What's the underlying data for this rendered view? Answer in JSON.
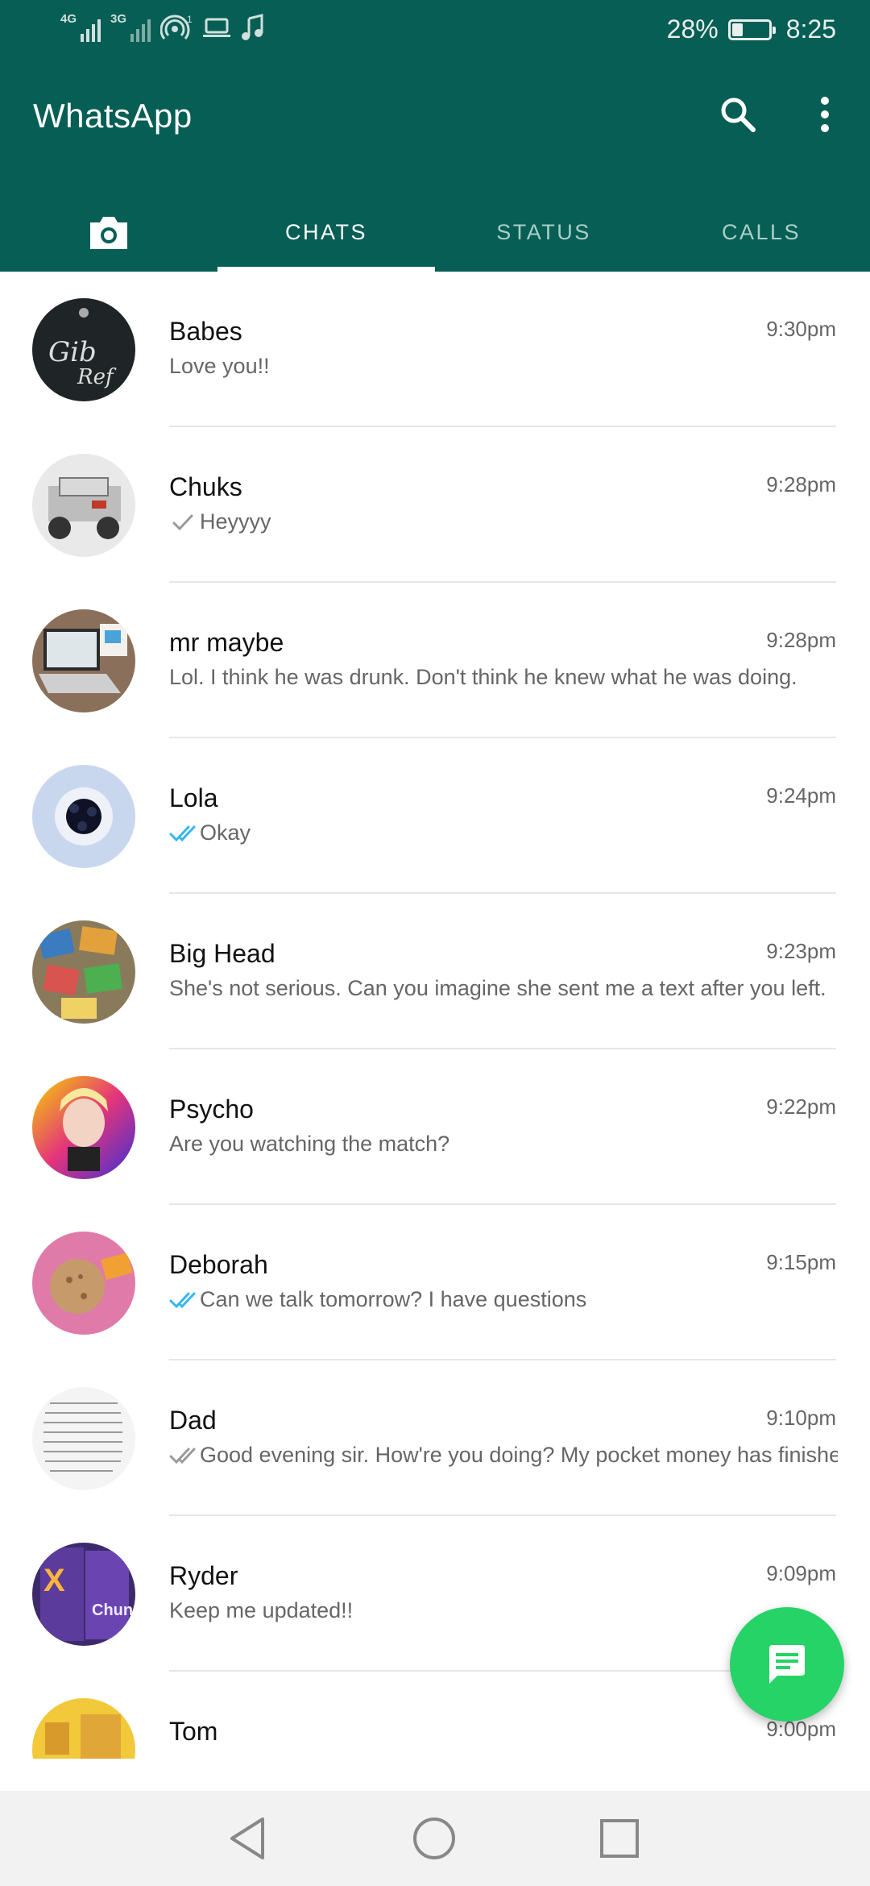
{
  "status_bar": {
    "network1": "4G",
    "network2": "3G",
    "hotspot_count": "1",
    "battery_percent_text": "28%",
    "battery_level": 0.28,
    "time": "8:25",
    "icons": [
      "signal-4g-icon",
      "signal-3g-icon",
      "hotspot-icon",
      "laptop-icon",
      "music-note-icon",
      "battery-icon"
    ]
  },
  "header": {
    "title": "WhatsApp",
    "search_icon": "search-icon",
    "menu_icon": "more-vertical-icon",
    "color": "#075e54"
  },
  "tabs": [
    {
      "label": "",
      "icon": "camera-icon"
    },
    {
      "label": "CHATS",
      "active": true
    },
    {
      "label": "STATUS"
    },
    {
      "label": "CALLS"
    }
  ],
  "chats": [
    {
      "name": "Babes",
      "time": "9:30pm",
      "message": "Love you!!",
      "tick": "none",
      "avatar": "dark-logo"
    },
    {
      "name": "Chuks",
      "time": "9:28pm",
      "message": "Heyyyy",
      "tick": "single",
      "avatar": "robot"
    },
    {
      "name": "mr maybe",
      "time": "9:28pm",
      "message": "Lol. I think he was drunk. Don't think he knew what he was doing.",
      "tick": "none",
      "avatar": "laptop"
    },
    {
      "name": "Lola",
      "time": "9:24pm",
      "message": "Okay",
      "tick": "double-blue",
      "avatar": "flower"
    },
    {
      "name": "Big Head",
      "time": "9:23pm",
      "message": "She's not serious. Can you imagine she sent me a text after you left.",
      "tick": "none",
      "avatar": "books"
    },
    {
      "name": "Psycho",
      "time": "9:22pm",
      "message": "Are you watching the match?",
      "tick": "none",
      "avatar": "colorful"
    },
    {
      "name": "Deborah",
      "time": "9:15pm",
      "message": "Can we talk tomorrow? I have questions",
      "tick": "double-blue",
      "avatar": "cookie"
    },
    {
      "name": "Dad",
      "time": "9:10pm",
      "message": "Good evening sir. How're you doing? My pocket money has finished",
      "tick": "double-grey",
      "avatar": "document"
    },
    {
      "name": "Ryder",
      "time": "9:09pm",
      "message": "Keep me updated!!",
      "tick": "none",
      "avatar": "purple-can"
    },
    {
      "name": "Tom",
      "time": "9:00pm",
      "message": "",
      "tick": "none",
      "avatar": "yellow"
    }
  ],
  "fab": {
    "icon": "new-chat-icon",
    "color": "#25d366"
  },
  "nav_bar": {
    "icons": [
      "back-icon",
      "home-icon",
      "recents-icon"
    ]
  }
}
